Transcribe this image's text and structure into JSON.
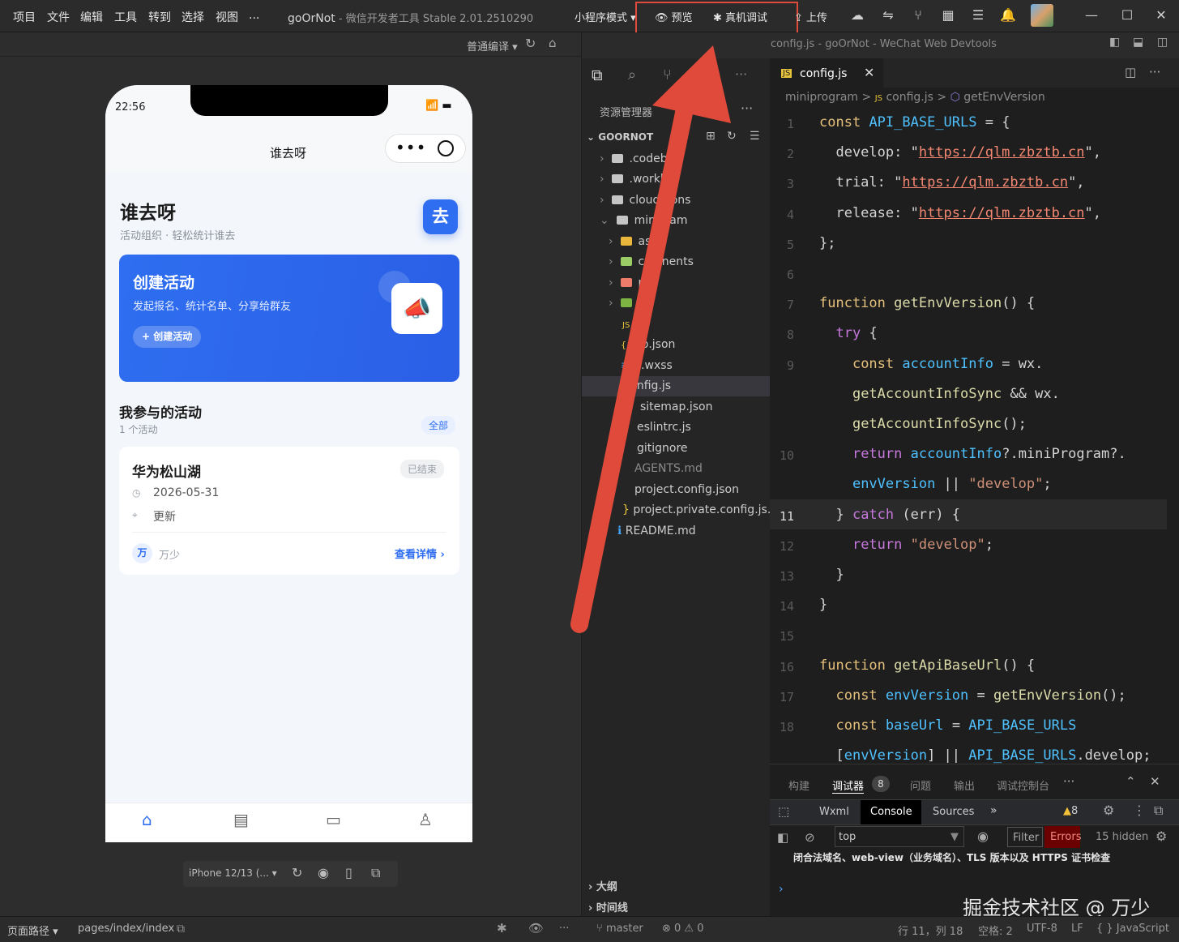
{
  "menu": [
    "项目",
    "文件",
    "编辑",
    "工具",
    "转到",
    "选择",
    "视图",
    "..."
  ],
  "app": {
    "project": "goOrNot",
    "subtitle": " - 微信开发者工具 Stable 2.01.2510290"
  },
  "toolbar": {
    "mode": "小程序模式 ▾",
    "preview": "预览",
    "remote_debug": "真机调试",
    "upload": "上传",
    "compile": "普通编译 ▾"
  },
  "window_title": "config.js - goOrNot - WeChat Web Devtools",
  "phone": {
    "time": "22:56",
    "nav_title": "谁去呀",
    "brand": "谁去呀",
    "tagline": "活动组织 · 轻松统计谁去",
    "logo_char": "去",
    "hero": {
      "title": "创建活动",
      "desc": "发起报名、统计名单、分享给群友",
      "button": "+ 创建活动"
    },
    "section": {
      "title": "我参与的活动",
      "count": "1 个活动",
      "all": "全部"
    },
    "activity": {
      "name": "华为松山湖",
      "status": "已结束",
      "date": "2026-05-31",
      "note": "更新",
      "avatar_char": "万",
      "owner": "万少",
      "detail": "查看详情 ›"
    },
    "tabs": [
      "首页",
      "活动",
      "消息",
      "我的"
    ]
  },
  "device": {
    "model": "iPhone 12/13 (... ▾"
  },
  "explorer": {
    "title": "资源管理器",
    "root": "GOORNOT",
    "items": [
      ".codebu",
      ".workb",
      "cloudf    ions",
      "minip     am",
      "ass",
      "co     onents",
      "p",
      "u",
      "   js",
      "  p.json",
      "  p.wxss",
      "onfig.js",
      "sitemap.json",
      "eslintrc.js",
      "gitignore",
      "AGENTS.md",
      "project.config.json",
      "project.private.config.js...",
      "README.md"
    ],
    "outline": "大纲",
    "timeline": "时间线"
  },
  "editor": {
    "tab": "config.js",
    "breadcrumb": [
      "miniprogram",
      ">",
      "config.js",
      ">",
      "getEnvVersion"
    ],
    "line_numbers": [
      "1",
      "2",
      "3",
      "4",
      "5",
      "6",
      "7",
      "8",
      "9",
      "",
      "",
      "10",
      "",
      "11",
      "12",
      "13",
      "14",
      "15",
      "16",
      "17",
      "18",
      ""
    ],
    "lines": [
      "const API_BASE_URLS = {",
      "  develop: \"https://qlm.zbztb.cn\",",
      "  trial: \"https://qlm.zbztb.cn\",",
      "  release: \"https://qlm.zbztb.cn\",",
      "};",
      "",
      "function getEnvVersion() {",
      "  try {",
      "    const accountInfo = wx.",
      "    getAccountInfoSync && wx.",
      "    getAccountInfoSync();",
      "    return accountInfo?.miniProgram?.",
      "    envVersion || \"develop\";",
      "  } catch (err) {",
      "    return \"develop\";",
      "  }",
      "}",
      "",
      "function getApiBaseUrl() {",
      "  const envVersion = getEnvVersion();",
      "  const baseUrl = API_BASE_URLS",
      "  [envVersion] || API_BASE_URLS.develop;"
    ]
  },
  "panel": {
    "tabs": [
      "构建",
      "调试器",
      "问题",
      "输出",
      "调试控制台"
    ],
    "badge": "8",
    "devtabs": [
      "Wxml",
      "Console",
      "Sources",
      "»"
    ],
    "warn": "8",
    "context": "top",
    "filter": "Filter",
    "errors": "Errors",
    "hidden": "15 hidden",
    "message": "闭合法域名、web-view（业务域名）、TLS 版本以及 HTTPS 证书检查",
    "watermark": "掘金技术社区 @ 万少"
  },
  "status": {
    "path_label": "页面路径 ▾",
    "path": "pages/index/index",
    "branch": "master",
    "problems": "⊗ 0 ⚠ 0",
    "cursor": "行 11，列 18",
    "spaces": "空格: 2",
    "encoding": "UTF-8",
    "eol": "LF",
    "lang": "{ } JavaScript"
  }
}
